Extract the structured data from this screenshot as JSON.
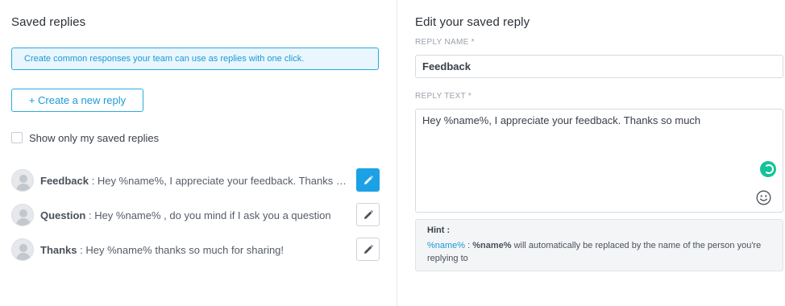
{
  "left": {
    "title": "Saved replies",
    "info": "Create common responses your team can use as replies with one click.",
    "create_button": "+ Create a new reply",
    "filter_label": "Show only my saved replies",
    "replies": [
      {
        "name": "Feedback",
        "separator": " : ",
        "text": "Hey %name%, I appreciate your feedback. Thanks so much",
        "active": true
      },
      {
        "name": "Question",
        "separator": " : ",
        "text": "Hey %name% , do you mind if I ask you a question",
        "active": false
      },
      {
        "name": "Thanks",
        "separator": " : ",
        "text": "Hey %name% thanks so much for sharing!",
        "active": false
      }
    ]
  },
  "right": {
    "title": "Edit your saved reply",
    "name_label": "REPLY NAME *",
    "name_value": "Feedback",
    "text_label": "REPLY TEXT *",
    "text_value": "Hey %name%, I appreciate your feedback. Thanks so much",
    "hint": {
      "title": "Hint :",
      "variable": "%name%",
      "sep": " : ",
      "bold_var": "%name%",
      "line1_rest": " will automatically be replaced by the name of the person you're",
      "line2": "replying to"
    }
  },
  "colors": {
    "accent": "#1da1e6",
    "info_bg": "#e9f6fd",
    "grammarly": "#15c39a"
  }
}
